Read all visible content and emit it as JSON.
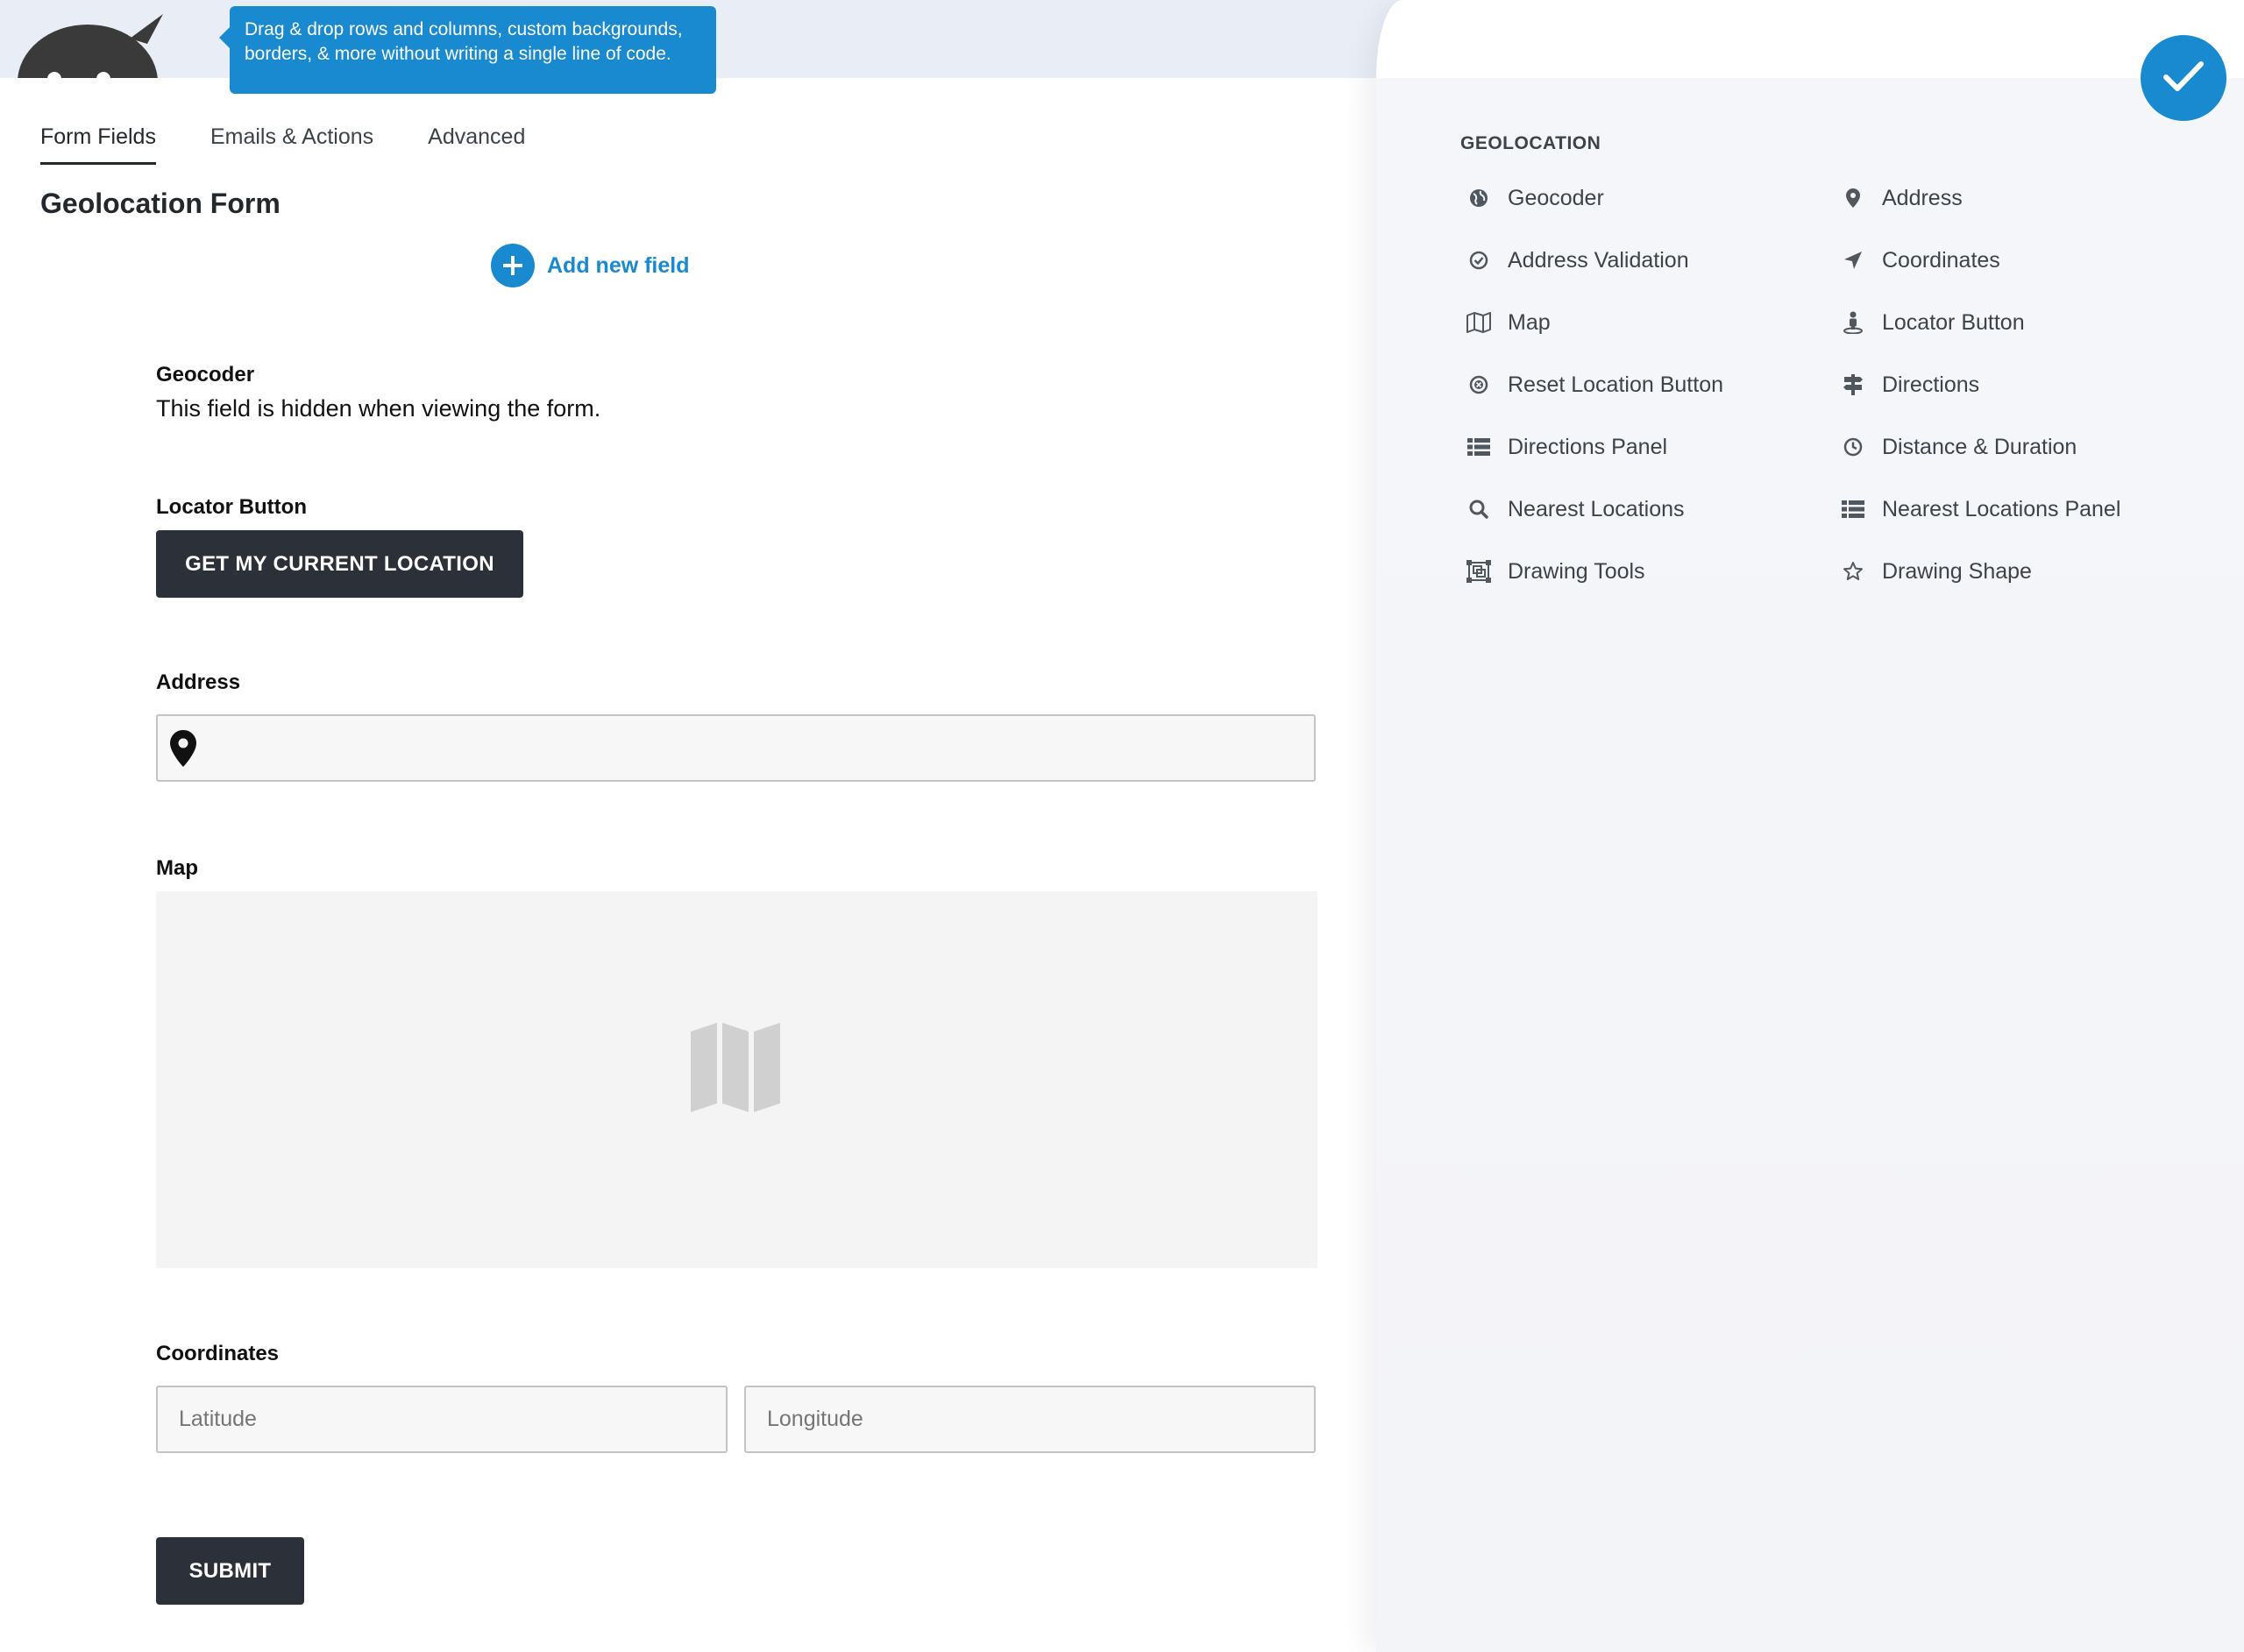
{
  "header": {
    "tooltip_text": "Drag & drop rows and columns, custom backgrounds, borders, & more without writing a single line of code."
  },
  "tabs": [
    {
      "label": "Form Fields",
      "active": true
    },
    {
      "label": "Emails & Actions",
      "active": false
    },
    {
      "label": "Advanced",
      "active": false
    }
  ],
  "form": {
    "title": "Geolocation Form",
    "add_field_label": "Add new field",
    "geocoder": {
      "label": "Geocoder",
      "description": "This field is hidden when viewing the form."
    },
    "locator": {
      "label": "Locator Button",
      "button_label": "GET MY CURRENT LOCATION"
    },
    "address": {
      "label": "Address",
      "value": ""
    },
    "map": {
      "label": "Map"
    },
    "coordinates": {
      "label": "Coordinates",
      "latitude_placeholder": "Latitude",
      "longitude_placeholder": "Longitude"
    },
    "submit_label": "SUBMIT"
  },
  "panel": {
    "heading": "GEOLOCATION",
    "items": [
      {
        "label": "Geocoder",
        "icon": "globe-icon"
      },
      {
        "label": "Address",
        "icon": "map-pin-icon"
      },
      {
        "label": "Address Validation",
        "icon": "check-circle-icon"
      },
      {
        "label": "Coordinates",
        "icon": "location-arrow-icon"
      },
      {
        "label": "Map",
        "icon": "map-icon"
      },
      {
        "label": "Locator Button",
        "icon": "street-view-icon"
      },
      {
        "label": "Reset Location Button",
        "icon": "times-circle-icon"
      },
      {
        "label": "Directions",
        "icon": "signpost-icon"
      },
      {
        "label": "Directions Panel",
        "icon": "list-icon"
      },
      {
        "label": "Distance & Duration",
        "icon": "clock-icon"
      },
      {
        "label": "Nearest Locations",
        "icon": "search-icon"
      },
      {
        "label": "Nearest Locations Panel",
        "icon": "list-icon"
      },
      {
        "label": "Drawing Tools",
        "icon": "object-group-icon"
      },
      {
        "label": "Drawing Shape",
        "icon": "star-icon"
      }
    ]
  },
  "colors": {
    "accent": "#1a8ad0",
    "dark_button": "#2c3038",
    "header_bg": "#e9edf6"
  }
}
